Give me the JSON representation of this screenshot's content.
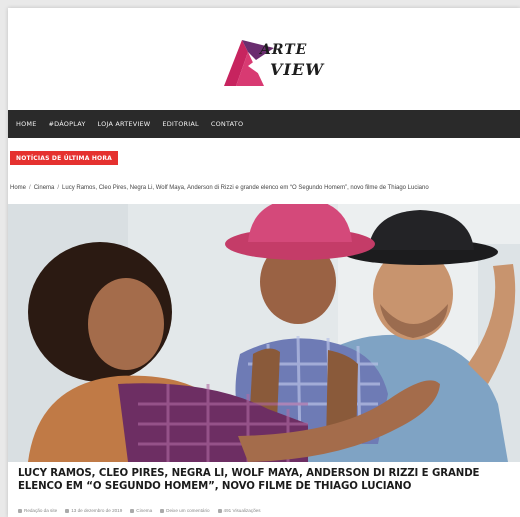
{
  "logo": {
    "line1": "ARTE",
    "line2": "VIEW"
  },
  "nav": {
    "items": [
      {
        "label": "HOME"
      },
      {
        "label": "#DÁOPLAY"
      },
      {
        "label": "LOJA ARTEVIEW"
      },
      {
        "label": "EDITORIAL"
      },
      {
        "label": "CONTATO"
      }
    ]
  },
  "breaking": {
    "label": "NOTÍCIAS DE ÚLTIMA HORA"
  },
  "breadcrumb": {
    "home": "Home",
    "category": "Cinema",
    "current": "Lucy Ramos, Cleo Pires, Negra Li, Wolf Maya, Anderson di Rizzi e grande elenco em “O Segundo Homem”, novo filme de Thiago Luciano"
  },
  "article": {
    "title": "LUCY RAMOS, CLEO PIRES, NEGRA LI, WOLF MAYA, ANDERSON DI RIZZI E GRANDE ELENCO EM “O SEGUNDO HOMEM”, NOVO FILME DE THIAGO LUCIANO",
    "meta": {
      "author": "Redação da site",
      "date": "13 de dezembro de 2019",
      "category": "Cinema",
      "comments": "Deixe um comentário",
      "views": "491 Visualizações"
    }
  },
  "colors": {
    "accent": "#e5312f",
    "logo_magenta": "#c7245f",
    "logo_purple": "#6a2d6f",
    "nav_bg": "#2a2a2a"
  }
}
